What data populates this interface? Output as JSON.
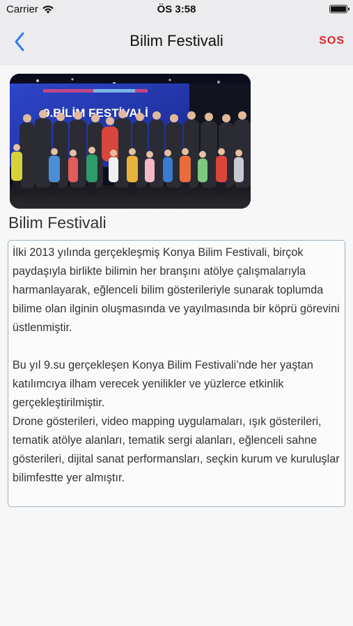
{
  "status_bar": {
    "carrier": "Carrier",
    "time": "ÖS 3:58",
    "icons": [
      "wifi-icon",
      "battery-icon"
    ]
  },
  "nav": {
    "title": "Bilim Festivali",
    "back_icon": "chevron-left-icon",
    "sos_label": "SOS",
    "accent_color": "#2f7cf6",
    "sos_color": "#e0262b"
  },
  "hero_image": {
    "stage_text": "9.BİLİM FESTİVALİ"
  },
  "content": {
    "heading": "Bilim Festivali",
    "paragraphs": [
      "İlki 2013 yılında gerçekleşmiş Konya Bilim Festivali, birçok paydaşıyla birlikte bilimin her branşını atölye çalışmalarıyla harmanlayarak, eğlenceli bilim gösterileriyle sunarak toplumda bilime olan ilginin oluşmasında ve yayılmasında bir köprü görevini üstlenmiştir.",
      "Bu yıl 9.su gerçekleşen Konya Bilim Festivali’nde her yaştan katılımcıya ilham verecek yenilikler ve yüzlerce etkinlik gerçekleştirilmiştir.",
      "Drone gösterileri, video mapping uygulamaları, ışık gösterileri, tematik atölye alanları, tematik sergi alanları, eğlenceli sahne gösterileri, dijital sanat performansları, seçkin kurum ve kuruluşlar bilimfestte yer almıştır."
    ]
  }
}
